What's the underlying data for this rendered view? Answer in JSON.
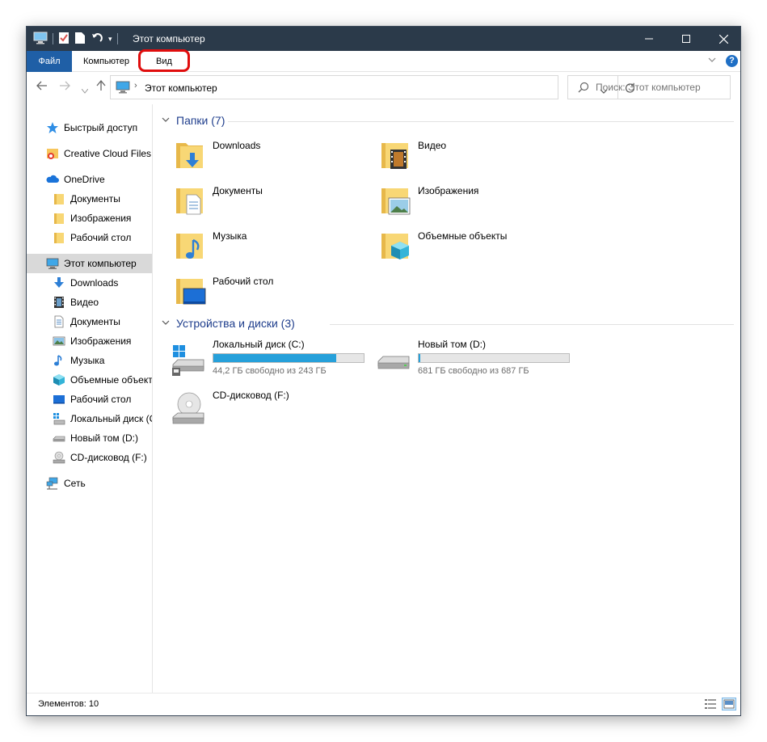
{
  "titlebar": {
    "title": "Этот компьютер"
  },
  "ribbon": {
    "tabs": [
      {
        "label": "Файл"
      },
      {
        "label": "Компьютер"
      },
      {
        "label": "Вид"
      }
    ]
  },
  "address": {
    "path": "Этот компьютер"
  },
  "search": {
    "placeholder": "Поиск: Этот компьютер"
  },
  "sidebar": {
    "items": [
      {
        "label": "Быстрый доступ",
        "icon": "star-icon"
      },
      {
        "label": "Creative Cloud Files",
        "icon": "creative-cloud-icon"
      },
      {
        "label": "OneDrive",
        "icon": "cloud-icon"
      },
      {
        "label": "Документы",
        "icon": "folder-icon"
      },
      {
        "label": "Изображения",
        "icon": "folder-icon"
      },
      {
        "label": "Рабочий стол",
        "icon": "folder-icon"
      },
      {
        "label": "Этот компьютер",
        "icon": "computer-icon"
      },
      {
        "label": "Downloads",
        "icon": "download-arrow-icon"
      },
      {
        "label": "Видео",
        "icon": "film-icon"
      },
      {
        "label": "Документы",
        "icon": "document-icon"
      },
      {
        "label": "Изображения",
        "icon": "picture-icon"
      },
      {
        "label": "Музыка",
        "icon": "music-note-icon"
      },
      {
        "label": "Объемные объект",
        "icon": "cube-icon"
      },
      {
        "label": "Рабочий стол",
        "icon": "desktop-icon"
      },
      {
        "label": "Локальный диск (C",
        "icon": "drive-icon"
      },
      {
        "label": "Новый том (D:)",
        "icon": "drive-icon"
      },
      {
        "label": "CD-дисковод (F:)",
        "icon": "cd-drive-icon"
      },
      {
        "label": "Сеть",
        "icon": "network-icon"
      }
    ]
  },
  "folders": {
    "heading": "Папки (7)",
    "items": [
      {
        "label": "Downloads",
        "icon": "downloads-folder-icon"
      },
      {
        "label": "Видео",
        "icon": "video-folder-icon"
      },
      {
        "label": "Документы",
        "icon": "documents-folder-icon"
      },
      {
        "label": "Изображения",
        "icon": "pictures-folder-icon"
      },
      {
        "label": "Музыка",
        "icon": "music-folder-icon"
      },
      {
        "label": "Объемные объекты",
        "icon": "3d-objects-folder-icon"
      },
      {
        "label": "Рабочий стол",
        "icon": "desktop-folder-icon"
      }
    ]
  },
  "devices": {
    "heading": "Устройства и диски (3)",
    "items": [
      {
        "label": "Локальный диск (C:)",
        "free": "44,2 ГБ свободно из 243 ГБ",
        "used_fraction": 0.818,
        "icon": "windows-drive-icon"
      },
      {
        "label": "Новый том (D:)",
        "free": "681 ГБ свободно из 687 ГБ",
        "used_fraction": 0.009,
        "icon": "drive-icon"
      },
      {
        "label": "CD-дисковод (F:)",
        "free": "",
        "icon": "cd-drive-icon"
      }
    ]
  },
  "status": {
    "count": "Элементов: 10"
  },
  "colors": {
    "titlebar": "#2b3a4a",
    "file_tab": "#1f5fa6",
    "progress": "#26a0da",
    "group_heading": "#1e3d8c",
    "highlight": "#e00d0d"
  }
}
